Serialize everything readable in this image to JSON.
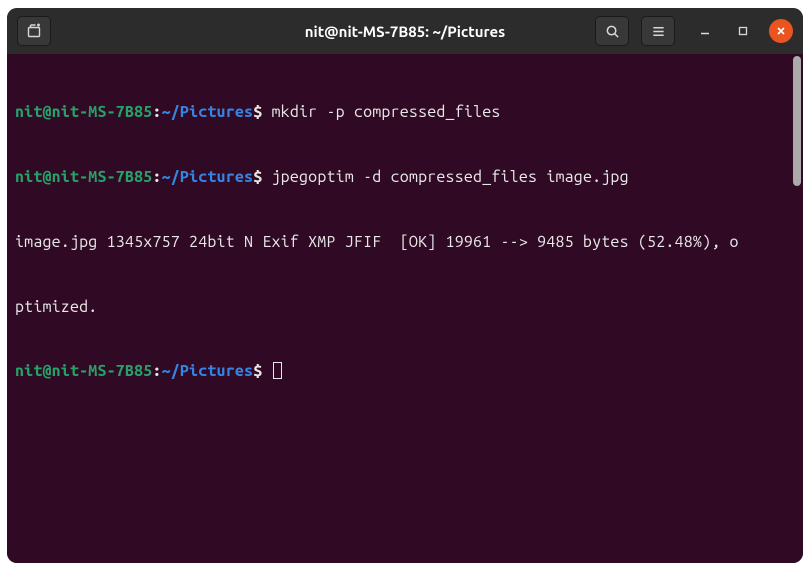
{
  "titlebar": {
    "title": "nit@nit-MS-7B85: ~/Pictures"
  },
  "terminal": {
    "lines": [
      {
        "type": "prompt",
        "user_host": "nit@nit-MS-7B85",
        "colon": ":",
        "cwd": "~/Pictures",
        "dollar": "$ ",
        "command": "mkdir -p compressed_files"
      },
      {
        "type": "prompt",
        "user_host": "nit@nit-MS-7B85",
        "colon": ":",
        "cwd": "~/Pictures",
        "dollar": "$ ",
        "command": "jpegoptim -d compressed_files image.jpg"
      },
      {
        "type": "output",
        "text1": "image.jpg 1345x757 24bit N Exif XMP JFIF  ",
        "ok": "[OK]",
        "text2": " 19961 --> 9485 bytes (52.48%), o"
      },
      {
        "type": "output_cont",
        "text": "ptimized."
      },
      {
        "type": "prompt_empty",
        "user_host": "nit@nit-MS-7B85",
        "colon": ":",
        "cwd": "~/Pictures",
        "dollar": "$ "
      }
    ]
  }
}
